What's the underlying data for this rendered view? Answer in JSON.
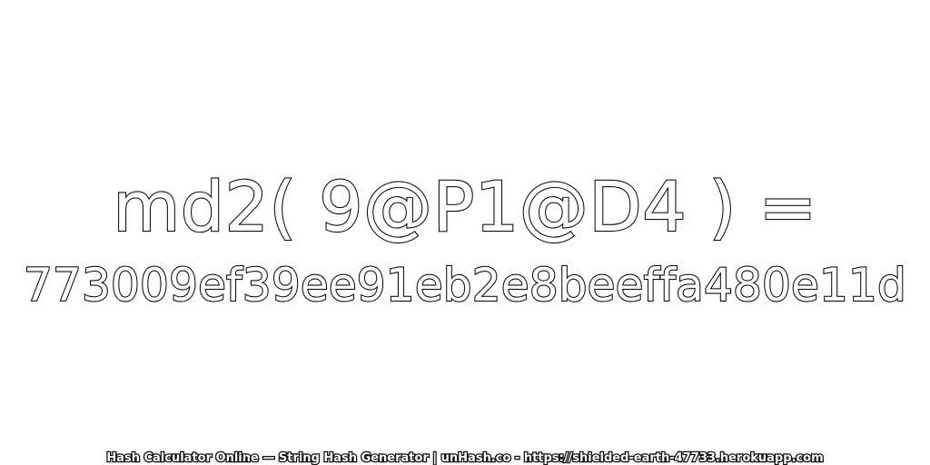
{
  "heading": {
    "expression": "md2( 9@P1@D4 ) =",
    "hash": "773009ef39ee91eb2e8beeffa480e11d"
  },
  "footer": {
    "text": "Hash Calculator Online — String Hash Generator | unHash.co - https://shielded-earth-47733.herokuapp.com"
  },
  "colors": {
    "background": "#ffffff",
    "outline": "#111111",
    "fill": "#ffffff"
  }
}
